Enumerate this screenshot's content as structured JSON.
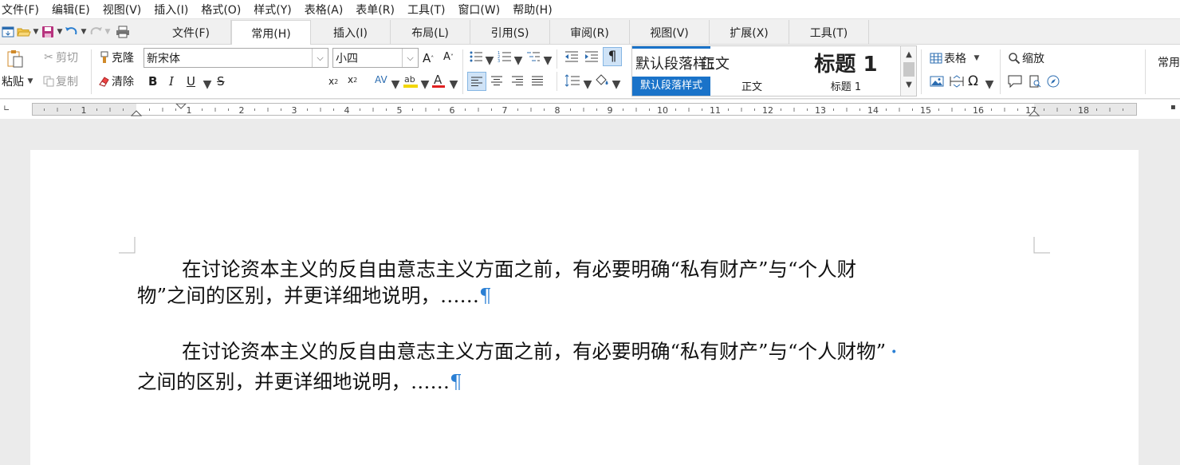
{
  "menu": [
    "文件(F)",
    "编辑(E)",
    "视图(V)",
    "插入(I)",
    "格式(O)",
    "样式(Y)",
    "表格(A)",
    "表单(R)",
    "工具(T)",
    "窗口(W)",
    "帮助(H)"
  ],
  "tabs": [
    {
      "label": "文件(F)",
      "active": false
    },
    {
      "label": "常用(H)",
      "active": true
    },
    {
      "label": "插入(I)",
      "active": false
    },
    {
      "label": "布局(L)",
      "active": false
    },
    {
      "label": "引用(S)",
      "active": false
    },
    {
      "label": "审阅(R)",
      "active": false
    },
    {
      "label": "视图(V)",
      "active": false
    },
    {
      "label": "扩展(X)",
      "active": false
    },
    {
      "label": "工具(T)",
      "active": false
    }
  ],
  "ribbon": {
    "paste": "粘贴",
    "cut": "剪切",
    "copy": "复制",
    "clone": "克隆",
    "clear": "清除",
    "font_name": "新宋体",
    "font_size": "小四",
    "table": "表格",
    "zoom": "缩放",
    "common": "常用",
    "styles": [
      {
        "preview": "默认段落样式",
        "name": "默认段落样式",
        "selected": true
      },
      {
        "preview": "正文",
        "name": "正文",
        "selected": false
      },
      {
        "preview": "标题 1",
        "name": "标题 1",
        "selected": false
      }
    ]
  },
  "ruler_numbers": [
    "1",
    "1",
    "2",
    "3",
    "4",
    "5",
    "6",
    "7",
    "8",
    "9",
    "10",
    "11",
    "12",
    "13",
    "14",
    "15",
    "16",
    "17",
    "18"
  ],
  "document": {
    "para1_line1": "在讨论资本主义的反自由意志主义方面之前，有必要明确“私有财产”与“个人财",
    "para1_line2": "物”之间的区别，并更详细地说明，……",
    "para2_line1": "在讨论资本主义的反自由意志主义方面之前，有必要明确“私有财产”与“个人财物”",
    "para2_line2": "之间的区别，并更详细地说明，……",
    "para_mark": "¶"
  },
  "colors": {
    "accent": "#1a73c9",
    "para_mark": "#2a7fd4"
  }
}
